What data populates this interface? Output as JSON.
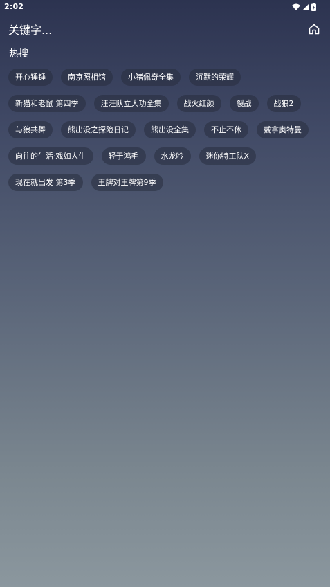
{
  "status_bar": {
    "time": "2:02",
    "icons": [
      "wifi-icon",
      "signal-icon",
      "battery-icon"
    ]
  },
  "search": {
    "placeholder": "关键字..."
  },
  "header": {
    "home_icon": "home-icon"
  },
  "hot": {
    "title": "热搜",
    "tags": [
      "开心锤锤",
      "南京照相馆",
      "小猪佩奇全集",
      "沉默的荣耀",
      "新猫和老鼠 第四季",
      "汪汪队立大功全集",
      "战火红颜",
      "裂战",
      "战狼2",
      "与狼共舞",
      "熊出没之探险日记",
      "熊出没全集",
      "不止不休",
      "戴拿奥特曼",
      "向往的生活·戏如人生",
      "轻于鸿毛",
      "水龙吟",
      "迷你特工队X",
      "现在就出发 第3季",
      "王牌对王牌第9季"
    ]
  },
  "colors": {
    "gradient_top": "#2c3350",
    "gradient_bottom": "#8b979e",
    "tag_background": "#282e3e",
    "text": "#ffffff"
  }
}
